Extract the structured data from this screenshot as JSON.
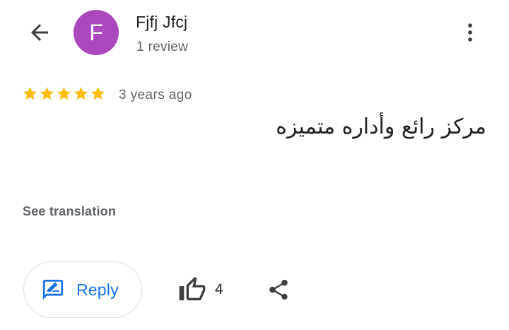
{
  "header": {
    "back_icon": "arrow-back-icon",
    "avatar": {
      "initial": "F",
      "color": "#ab47bc"
    },
    "author_name": "Fjfj Jfcj",
    "review_count": "1 review",
    "more_icon": "more-vert-icon"
  },
  "review": {
    "rating": 5,
    "max_rating": 5,
    "star_color": "#fbbc04",
    "time_ago": "3 years ago",
    "text": "مركز رائع وأداره متميزه",
    "see_translation": "See translation"
  },
  "actions": {
    "reply_label": "Reply",
    "reply_icon": "rate-review-icon",
    "like_icon": "thumb-up-outline-icon",
    "like_count": "4",
    "share_icon": "share-icon",
    "accent_color": "#1a73e8"
  }
}
